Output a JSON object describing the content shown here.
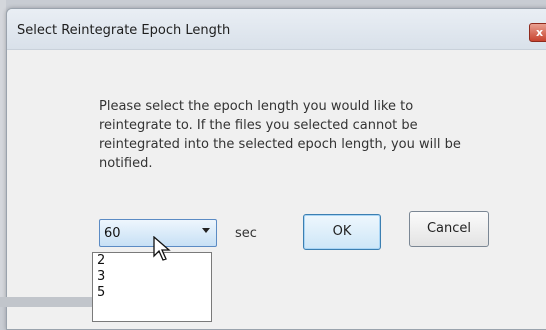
{
  "dialog": {
    "title": "Select Reintegrate Epoch Length",
    "close_label": "x",
    "message": "Please select the epoch length you would like to reintegrate to.  If the files you selected cannot be reintegrated into the selected epoch length, you will be notified.",
    "epoch_select": {
      "selected_value": "60",
      "unit": "sec",
      "options_visible": [
        "2",
        "3",
        "5"
      ]
    },
    "buttons": {
      "ok_label": "OK",
      "cancel_label": "Cancel"
    }
  },
  "colors": {
    "close_button": "#c7432f",
    "selected_button_border": "#3c7fb1",
    "combo_border": "#5b8bc4"
  },
  "icons": {
    "cursor": "arrow-cursor-icon",
    "combo_arrow": "chevron-down-icon"
  }
}
